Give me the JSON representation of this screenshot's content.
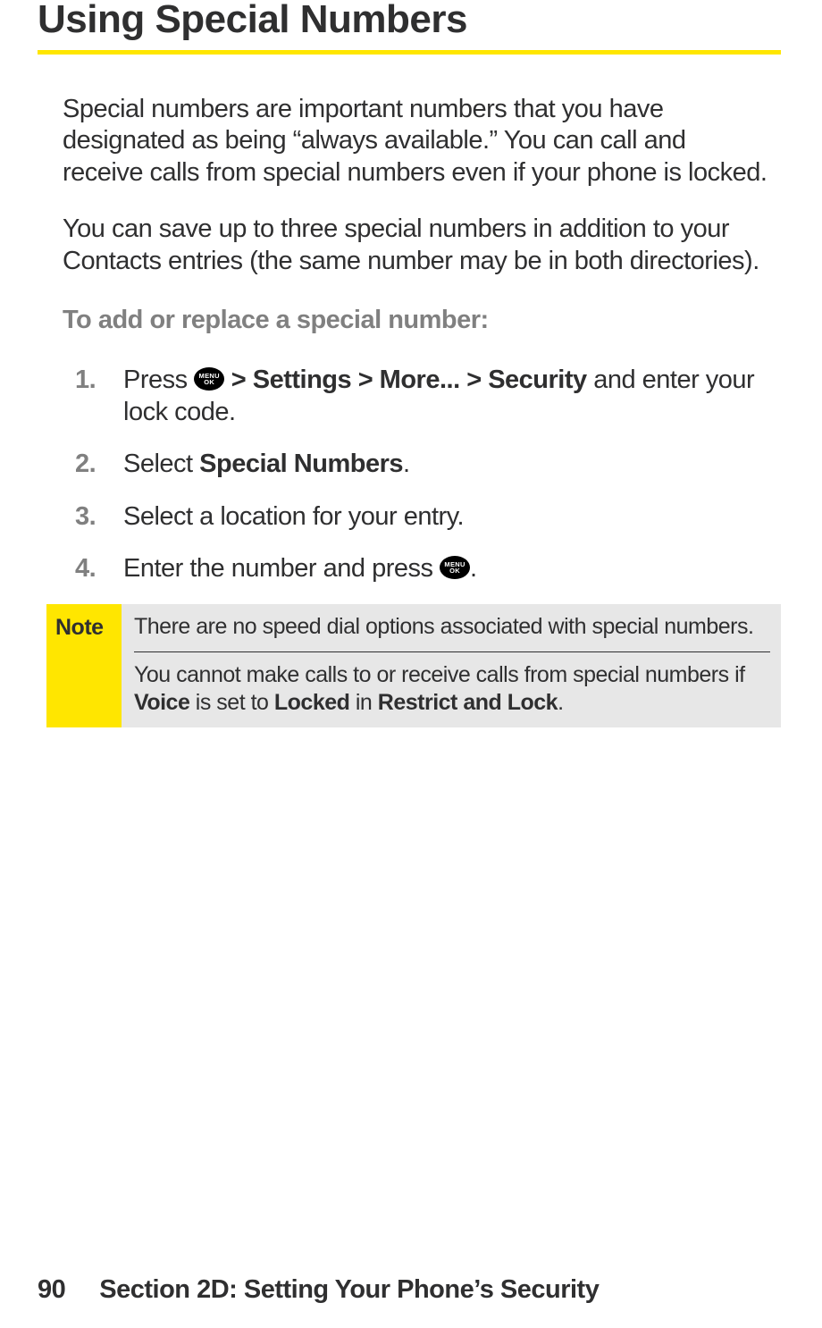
{
  "heading": "Using Special Numbers",
  "paragraphs": {
    "p1": "Special numbers are important numbers that you have designated as being “always available.” You can call and receive calls from special numbers even if your phone is locked.",
    "p2": "You can save up to three special numbers in addition to your Contacts entries (the same number may be in both directories)."
  },
  "sub_heading": "To add or replace a special number:",
  "steps": [
    {
      "num": "1.",
      "pre": "Press ",
      "bold": " > Settings > More... > Security ",
      "post": "and enter your lock code."
    },
    {
      "num": "2.",
      "pre": "Select ",
      "bold": "Special Numbers",
      "post": "."
    },
    {
      "num": "3.",
      "text": "Select a location for your entry."
    },
    {
      "num": "4.",
      "pre": "Enter the number and press ",
      "post": "."
    }
  ],
  "icon": {
    "line1": "MENU",
    "line2": "OK"
  },
  "note": {
    "label": "Note",
    "item1": "There are no speed dial options associated with special numbers.",
    "item2_a": "You cannot make calls to or receive calls from special numbers if ",
    "item2_b": "Voice",
    "item2_c": " is set to ",
    "item2_d": "Locked",
    "item2_e": " in ",
    "item2_f": "Restrict and Lock",
    "item2_g": "."
  },
  "footer": {
    "page_num": "90",
    "section": "Section 2D: Setting Your Phone’s Security"
  }
}
